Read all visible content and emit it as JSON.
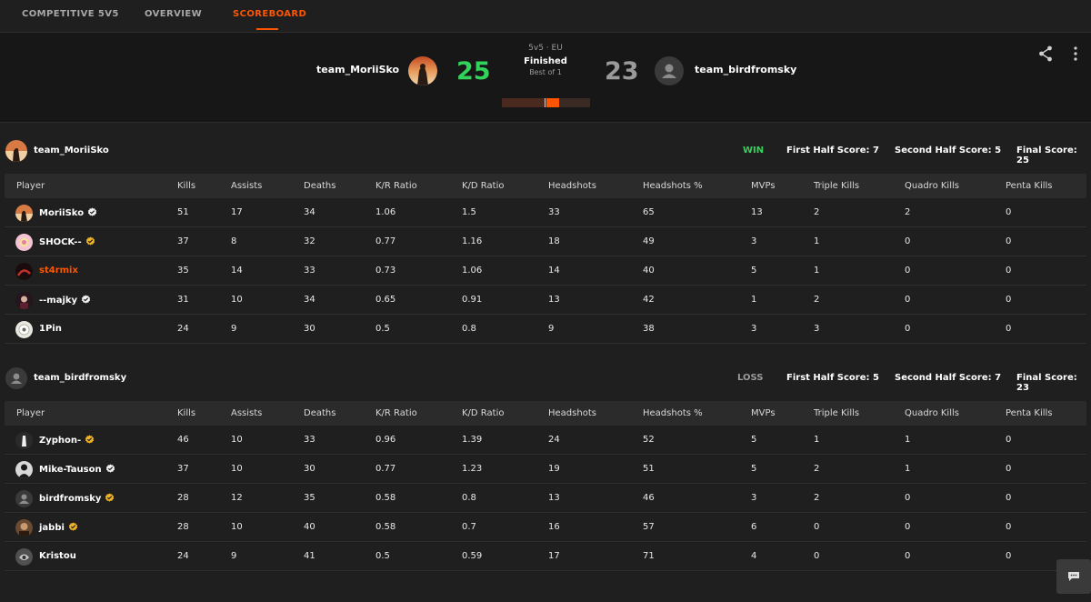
{
  "tabs": [
    {
      "label": "COMPETITIVE 5V5",
      "active": false
    },
    {
      "label": "OVERVIEW",
      "active": false
    },
    {
      "label": "SCOREBOARD",
      "active": true
    }
  ],
  "match": {
    "mode": "5v5 · EU",
    "status": "Finished",
    "format": "Best of 1",
    "team1": {
      "name": "team_MoriiSko",
      "score": "25"
    },
    "team2": {
      "name": "team_birdfromsky",
      "score": "23"
    },
    "progress_fraction": 0.52
  },
  "columns": [
    "Player",
    "Kills",
    "Assists",
    "Deaths",
    "K/R Ratio",
    "K/D Ratio",
    "Headshots",
    "Headshots %",
    "MVPs",
    "Triple Kills",
    "Quadro Kills",
    "Penta Kills"
  ],
  "teams": [
    {
      "name": "team_MoriiSko",
      "result": "WIN",
      "first_half": "First Half Score: 7",
      "second_half": "Second Half Score: 5",
      "final": "Final Score: 25",
      "players": [
        {
          "name": "MoriiSko",
          "verified": "white",
          "avatar": "sunset",
          "stats": [
            "51",
            "17",
            "34",
            "1.06",
            "1.5",
            "33",
            "65",
            "13",
            "2",
            "2",
            "0"
          ]
        },
        {
          "name": "SHOCK--",
          "verified": "gold",
          "avatar": "pink",
          "stats": [
            "37",
            "8",
            "32",
            "0.77",
            "1.16",
            "18",
            "49",
            "3",
            "1",
            "0",
            "0"
          ]
        },
        {
          "name": "st4rmix",
          "verified": "",
          "avatar": "dark-red",
          "highlight": true,
          "stats": [
            "35",
            "14",
            "33",
            "0.73",
            "1.06",
            "14",
            "40",
            "5",
            "1",
            "0",
            "0"
          ]
        },
        {
          "name": "--majky",
          "verified": "white",
          "avatar": "dark",
          "stats": [
            "31",
            "10",
            "34",
            "0.65",
            "0.91",
            "13",
            "42",
            "1",
            "2",
            "0",
            "0"
          ]
        },
        {
          "name": "1Pin",
          "verified": "",
          "avatar": "light",
          "stats": [
            "24",
            "9",
            "30",
            "0.5",
            "0.8",
            "9",
            "38",
            "3",
            "3",
            "0",
            "0"
          ]
        }
      ]
    },
    {
      "name": "team_birdfromsky",
      "result": "LOSS",
      "first_half": "First Half Score: 5",
      "second_half": "Second Half Score: 7",
      "final": "Final Score: 23",
      "players": [
        {
          "name": "Zyphon-",
          "verified": "gold",
          "avatar": "white-fig",
          "stats": [
            "46",
            "10",
            "33",
            "0.96",
            "1.39",
            "24",
            "52",
            "5",
            "1",
            "1",
            "0"
          ]
        },
        {
          "name": "Mike-Tauson",
          "verified": "white",
          "avatar": "bw",
          "stats": [
            "37",
            "10",
            "30",
            "0.77",
            "1.23",
            "19",
            "51",
            "5",
            "2",
            "1",
            "0"
          ]
        },
        {
          "name": "birdfromsky",
          "verified": "gold",
          "avatar": "default",
          "stats": [
            "28",
            "12",
            "35",
            "0.58",
            "0.8",
            "13",
            "46",
            "3",
            "2",
            "0",
            "0"
          ]
        },
        {
          "name": "jabbi",
          "verified": "gold",
          "avatar": "brown",
          "stats": [
            "28",
            "10",
            "40",
            "0.58",
            "0.7",
            "16",
            "57",
            "6",
            "0",
            "0",
            "0"
          ]
        },
        {
          "name": "Kristou",
          "verified": "",
          "avatar": "grey",
          "stats": [
            "24",
            "9",
            "41",
            "0.5",
            "0.59",
            "17",
            "71",
            "4",
            "0",
            "0",
            "0"
          ]
        }
      ]
    }
  ],
  "colors": {
    "accent": "#ff5500",
    "win": "#32d35a",
    "loss": "#9a9a9a"
  }
}
